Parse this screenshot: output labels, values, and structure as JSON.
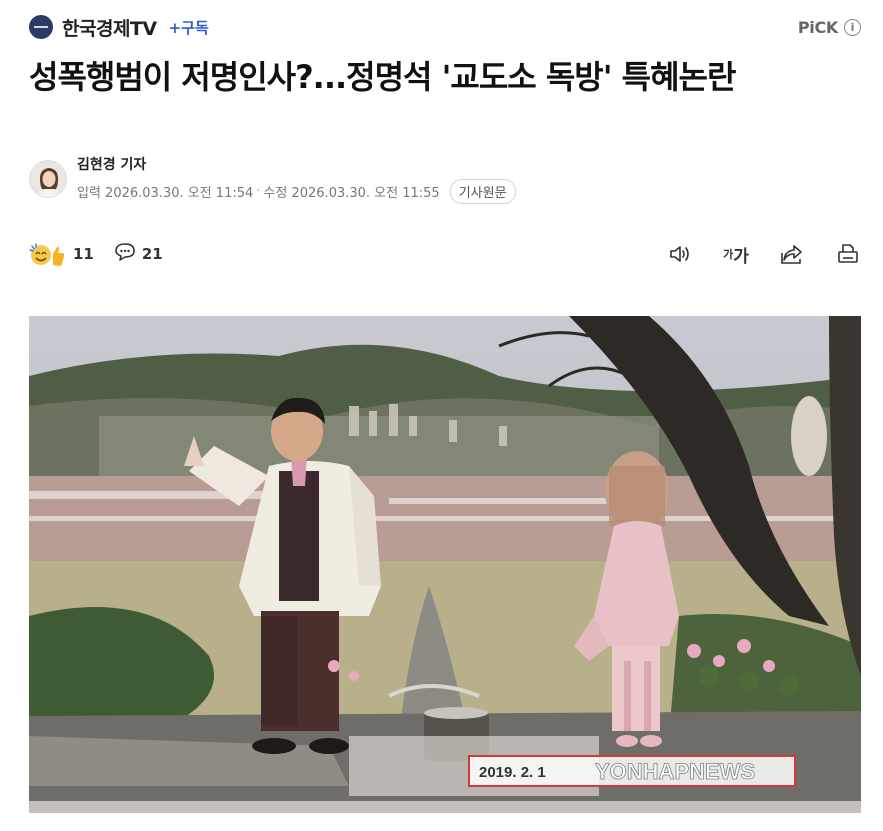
{
  "header": {
    "press_name": "한국경제TV",
    "subscribe_label": "+구독",
    "pick_label": "PiCK",
    "info_glyph": "i"
  },
  "article": {
    "title": "성폭행범이 저명인사?...정명석 '교도소 독방' 특혜논란",
    "reporter": "김현경 기자",
    "published": "입력 2026.03.30. 오전 11:54",
    "separator": "·",
    "modified": "수정 2026.03.30. 오전 11:55",
    "original_button": "기사원문"
  },
  "toolbar": {
    "reaction_count": "11",
    "comment_count": "21",
    "font_size_small": "가",
    "font_size_large": "가"
  },
  "photo": {
    "caption_date": "2019. 2. 1",
    "watermark": "YONHAPNEWS"
  },
  "icons": [
    "press-logo",
    "info-icon",
    "reaction-emoji-icon",
    "comment-icon",
    "speaker-icon",
    "font-size-icon",
    "share-icon",
    "print-icon"
  ],
  "colors": {
    "subscribe": "#2f5fd1",
    "press_logo": "#2b3a67",
    "title": "#111111",
    "meta": "#777777"
  }
}
